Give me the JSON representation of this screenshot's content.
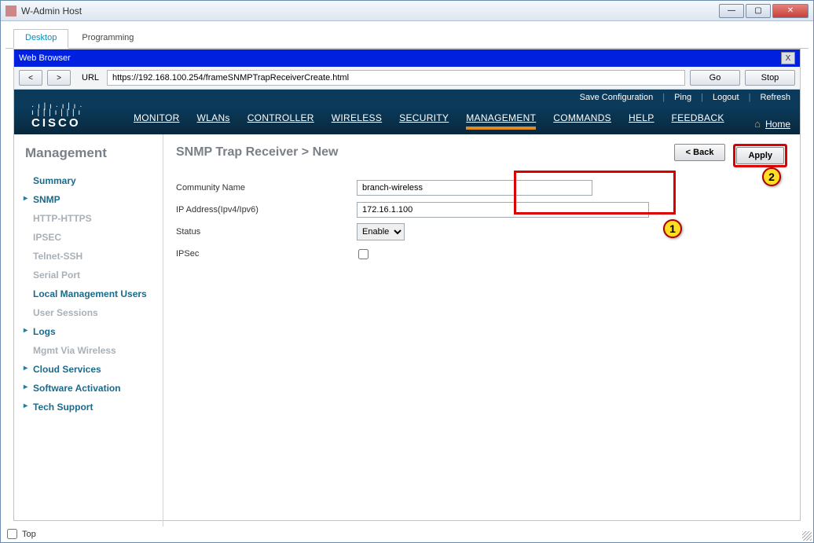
{
  "window": {
    "title": "W-Admin Host",
    "topCheckbox": "Top"
  },
  "tabs": {
    "desktop": "Desktop",
    "programming": "Programming"
  },
  "browser": {
    "title": "Web Browser",
    "back": "<",
    "forward": ">",
    "urlLabel": "URL",
    "url": "https://192.168.100.254/frameSNMPTrapReceiverCreate.html",
    "go": "Go",
    "stop": "Stop",
    "close": "X"
  },
  "cisco": {
    "logoText": "CISCO",
    "topLinks": {
      "save": "Save Configuration",
      "ping": "Ping",
      "logout": "Logout",
      "refresh": "Refresh"
    },
    "nav": {
      "monitor": "MONITOR",
      "wlans": "WLANs",
      "controller": "CONTROLLER",
      "wireless": "WIRELESS",
      "security": "SECURITY",
      "management": "MANAGEMENT",
      "commands": "COMMANDS",
      "help": "HELP",
      "feedback": "FEEDBACK",
      "home": "Home"
    }
  },
  "sidebar": {
    "heading": "Management",
    "items": [
      {
        "label": "Summary",
        "bold": true
      },
      {
        "label": "SNMP",
        "arrow": true,
        "bold": true
      },
      {
        "label": "HTTP-HTTPS",
        "disabled": true,
        "bold": true
      },
      {
        "label": "IPSEC",
        "disabled": true,
        "bold": true
      },
      {
        "label": "Telnet-SSH",
        "disabled": true,
        "bold": true
      },
      {
        "label": "Serial Port",
        "disabled": true,
        "bold": true
      },
      {
        "label": "Local Management Users",
        "bold": true
      },
      {
        "label": "User Sessions",
        "disabled": true,
        "bold": true
      },
      {
        "label": "Logs",
        "arrow": true,
        "bold": true
      },
      {
        "label": "Mgmt Via Wireless",
        "disabled": true,
        "bold": true
      },
      {
        "label": "Cloud Services",
        "arrow": true,
        "bold": true
      },
      {
        "label": "Software Activation",
        "arrow": true,
        "bold": true
      },
      {
        "label": "Tech Support",
        "arrow": true,
        "bold": true
      }
    ]
  },
  "page": {
    "breadcrumb": "SNMP Trap Receiver > New",
    "back": "< Back",
    "apply": "Apply",
    "form": {
      "communityLabel": "Community Name",
      "communityValue": "branch-wireless",
      "ipLabel": "IP Address(Ipv4/Ipv6)",
      "ipValue": "172.16.1.100",
      "statusLabel": "Status",
      "statusValue": "Enable",
      "ipsecLabel": "IPSec"
    },
    "callouts": {
      "one": "1",
      "two": "2"
    }
  }
}
